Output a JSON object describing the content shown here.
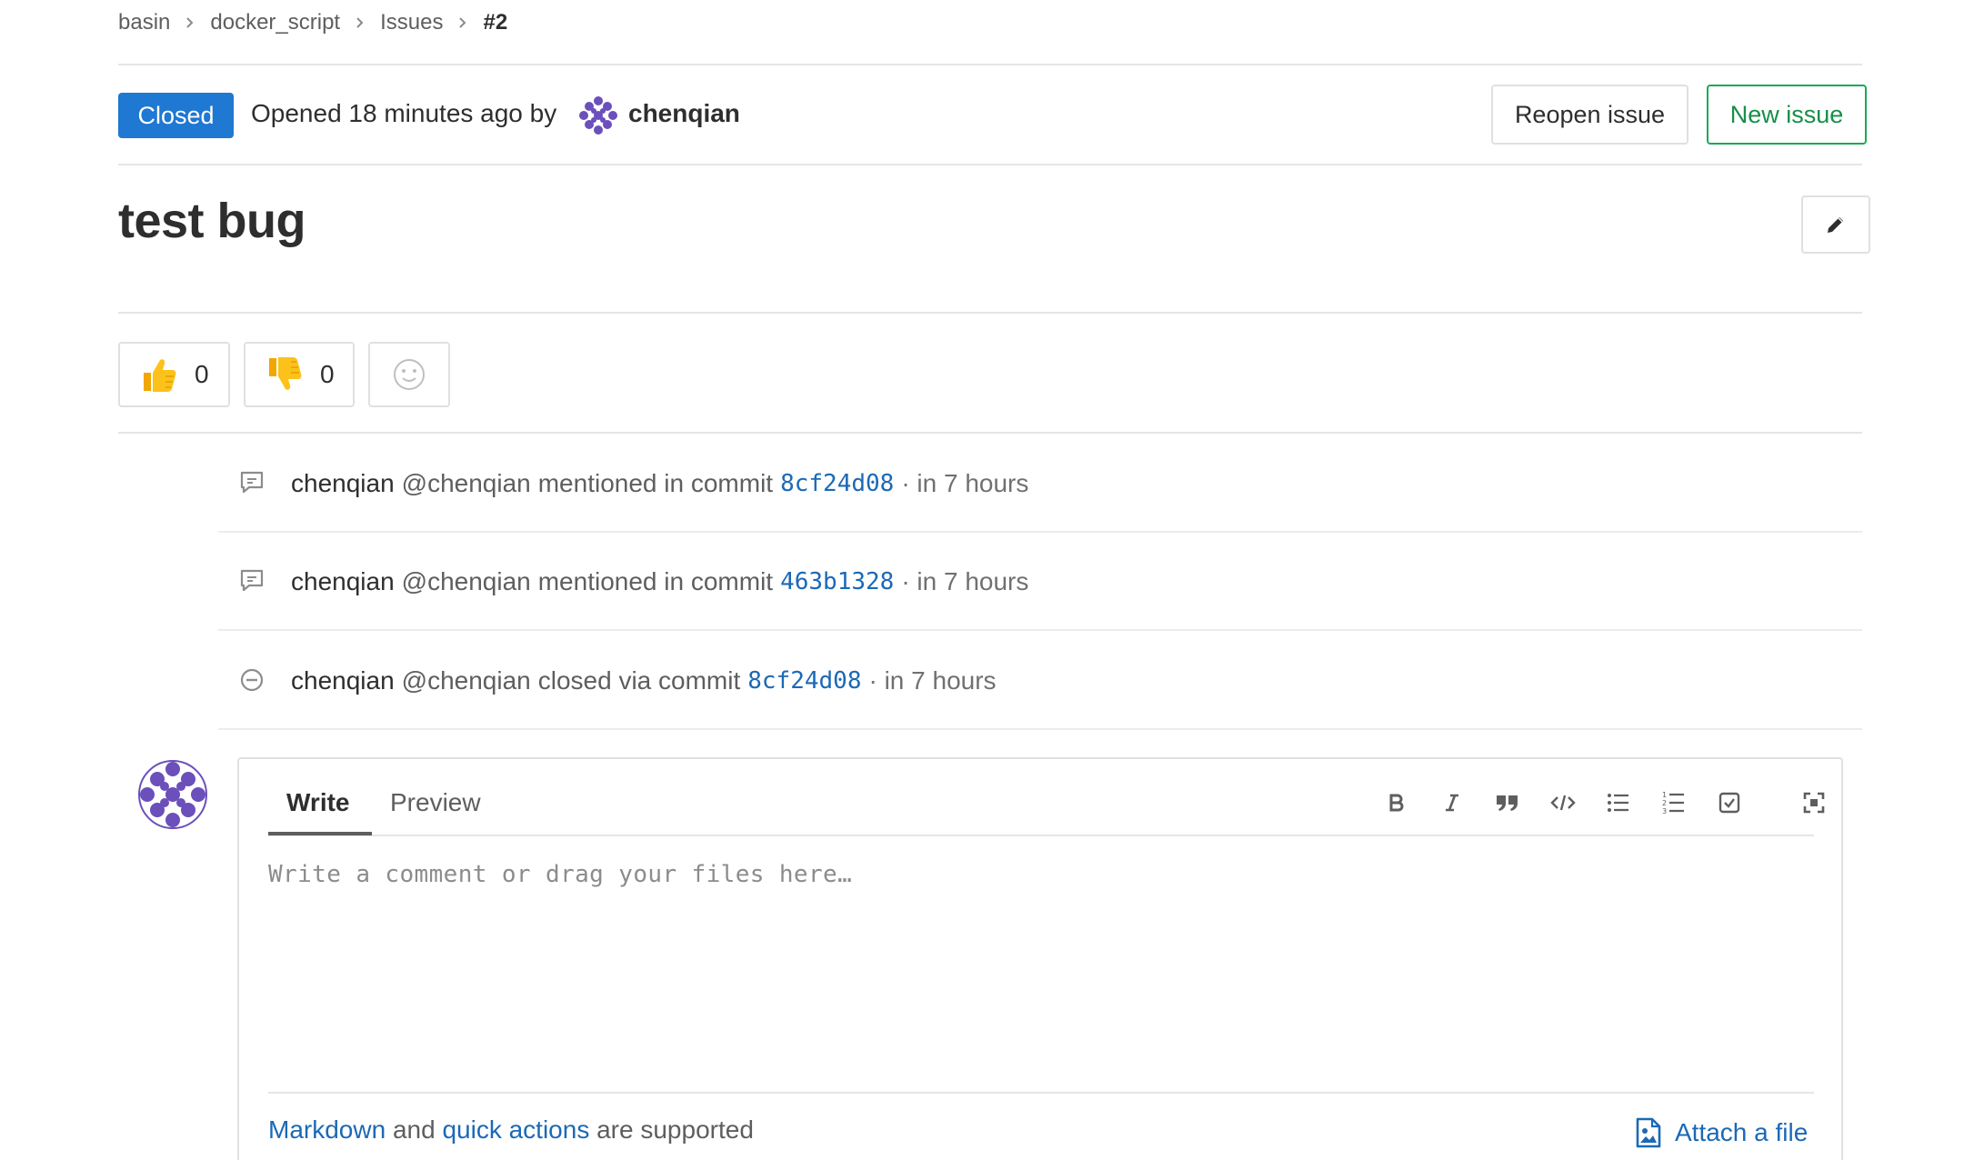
{
  "breadcrumb": {
    "items": [
      "basin",
      "docker_script",
      "Issues"
    ],
    "current": "#2"
  },
  "issue": {
    "status": "Closed",
    "opened_text": "Opened 18 minutes ago by",
    "author": "chenqian",
    "title": "test bug",
    "status_color": "#1f78d1"
  },
  "actions": {
    "reopen_label": "Reopen issue",
    "new_issue_label": "New issue"
  },
  "awards": {
    "thumbs_up_count": "0",
    "thumbs_down_count": "0"
  },
  "notes": [
    {
      "author": "chenqian",
      "handle": "@chenqian",
      "action": "mentioned in commit",
      "commit": "8cf24d08",
      "time": "· in 7 hours",
      "icon": "comment-icon"
    },
    {
      "author": "chenqian",
      "handle": "@chenqian",
      "action": "mentioned in commit",
      "commit": "463b1328",
      "time": "· in 7 hours",
      "icon": "comment-icon"
    },
    {
      "author": "chenqian",
      "handle": "@chenqian",
      "action": "closed via commit",
      "commit": "8cf24d08",
      "time": "· in 7 hours",
      "icon": "closed-icon"
    }
  ],
  "comment_form": {
    "tab_write": "Write",
    "tab_preview": "Preview",
    "placeholder": "Write a comment or drag your files here…",
    "help_markdown": "Markdown",
    "help_and": "and",
    "help_quick_actions": "quick actions",
    "help_supported": "are supported",
    "attach_label": "Attach a file",
    "toolbar": [
      "bold-icon",
      "italic-icon",
      "quote-icon",
      "code-icon",
      "bullet-list-icon",
      "numbered-list-icon",
      "task-list-icon",
      "fullscreen-icon"
    ]
  },
  "colors": {
    "link": "#1b69b6",
    "new_issue_border": "#1aaa55",
    "avatar": "#6b4fbb"
  }
}
